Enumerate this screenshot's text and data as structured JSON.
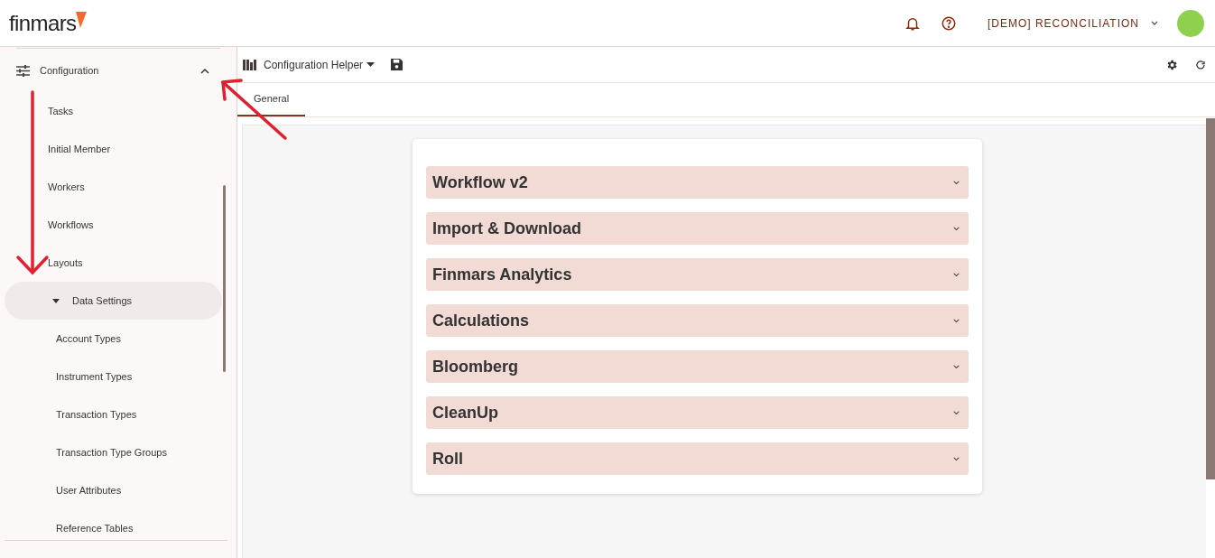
{
  "header": {
    "logo": "finmars",
    "workspace": "[DEMO] RECONCILIATION"
  },
  "sidebar": {
    "items": [
      {
        "label": "Configuration",
        "expanded": true,
        "children": [
          {
            "label": "Tasks"
          },
          {
            "label": "Initial Member"
          },
          {
            "label": "Workers"
          },
          {
            "label": "Workflows"
          },
          {
            "label": "Layouts"
          },
          {
            "label": "Data Settings",
            "expanded": true,
            "selected": true,
            "children": [
              {
                "label": "Account Types"
              },
              {
                "label": "Instrument Types"
              },
              {
                "label": "Transaction Types"
              },
              {
                "label": "Transaction Type Groups"
              },
              {
                "label": "User Attributes"
              },
              {
                "label": "Reference Tables"
              }
            ]
          }
        ]
      }
    ]
  },
  "toolbar": {
    "title": "Configuration Helper"
  },
  "tabs": [
    {
      "label": "General",
      "selected": true
    }
  ],
  "sections": [
    {
      "title": "Workflow v2",
      "expanded": false
    },
    {
      "title": "Import & Download",
      "expanded": false
    },
    {
      "title": "Finmars Analytics",
      "expanded": false
    },
    {
      "title": "Calculations",
      "expanded": false
    },
    {
      "title": "Bloomberg",
      "expanded": false
    },
    {
      "title": "CleanUp",
      "expanded": false
    },
    {
      "title": "Roll",
      "expanded": false
    }
  ]
}
